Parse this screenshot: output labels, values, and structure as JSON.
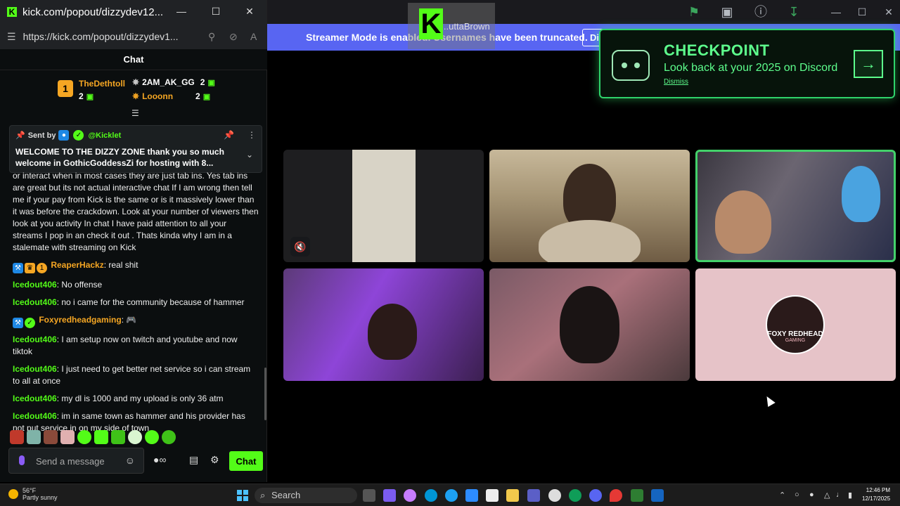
{
  "kick_window": {
    "title": "kick.com/popout/dizzydev12...",
    "url": "https://kick.com/popout/dizzydev1...",
    "chat_header": "Chat",
    "leaderboard": {
      "first": {
        "rank": "1",
        "name": "TheDethtoll",
        "count": "2"
      },
      "second": {
        "name": "2AM_AK_GG",
        "count": "2"
      },
      "third": {
        "name": "Looonn",
        "count": "2"
      }
    },
    "pinned": {
      "sent_by_label": "Sent by",
      "sender": "@Kicklet",
      "text": "WELCOME TO THE DIZZY ZONE thank you so much welcome in GothicGoddessZi for hosting with 8..."
    },
    "messages": [
      {
        "user": "",
        "text": "or interact when in most cases they are just tab ins. Yes tab ins are great but its not actual interactive chat If I am wrong then tell me if your pay from Kick is the same or is it massively lower than it was before the crackdown. Look at your number of viewers then look at you activity In chat I have paid attention to all your streams I pop in an check it out . Thats kinda why I am in a stalemate with streaming on Kick"
      },
      {
        "user": "ReaperHackz",
        "text": "real shit",
        "style": "orange"
      },
      {
        "user": "Icedout406",
        "text": "No offense"
      },
      {
        "user": "Icedout406",
        "text": "no i came for the community because of hammer"
      },
      {
        "user": "Foxyredheadgaming",
        "text": "",
        "style": "orange"
      },
      {
        "user": "Icedout406",
        "text": "I am setup now on twitch and youtube and now tiktok"
      },
      {
        "user": "Icedout406",
        "text": "I just need to get better net service so i can stream to all at once"
      },
      {
        "user": "Icedout406",
        "text": "my dl is 1000 and my upload is only 36 atm"
      },
      {
        "user": "Icedout406",
        "text": "im in same town as hammer and his provider has not put service in on my side of town"
      }
    ],
    "input_placeholder": "Send a message",
    "chat_button": "Chat"
  },
  "discord": {
    "streamer_banner": "Streamer Mode is enabled. Usernames have been truncated.",
    "banner_button": "Di",
    "overlay_name": "...uttaBrown",
    "checkpoint": {
      "title": "CHECKPOINT",
      "subtitle": "Look back at your 2025 on Discord",
      "dismiss": "Dismiss"
    },
    "foxy_logo": {
      "line1": "FOXY REDHEAD",
      "line2": "GAMING"
    }
  },
  "taskbar": {
    "temp": "56°F",
    "condition": "Partly sunny",
    "search": "Search",
    "time": "12:46 PM",
    "date": "12/17/2025"
  },
  "colors": {
    "kick_green": "#53fc18",
    "discord_blurple": "#5865f2",
    "checkpoint_green": "#5dfd8c"
  }
}
